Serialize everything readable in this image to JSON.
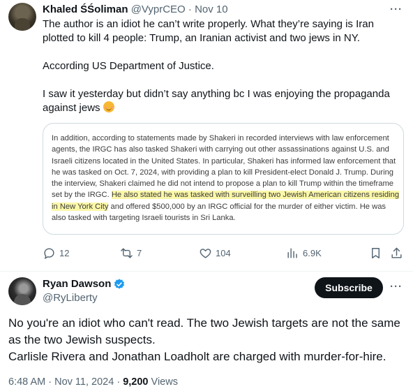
{
  "tweet1": {
    "author_name": "Khaled ŚŚoliman",
    "author_handle": "@VyprCEO",
    "separator": "·",
    "date": "Nov 10",
    "text_line1": "The author is an idiot he can’t write properly. What they’re saying is Iran plotted to kill 4 people: Trump, an Iranian activist and two jews in NY.",
    "text_line2": "According US Department of Justice.",
    "text_line3": "I saw it yesterday but didn’t say anything bc I was enjoying the propaganda against jews",
    "emoji": "smiling-face-with-smiling-eyes",
    "quote_before_highlight": "In addition, according to statements made by Shakeri in recorded interviews with law enforcement agents, the IRGC has also tasked Shakeri with carrying out other assassinations against U.S. and Israeli citizens located in the United States. In particular, Shakeri has informed law enforcement that he was tasked on Oct. 7, 2024, with providing a plan to kill President-elect Donald J. Trump. During the interview, Shakeri claimed he did not intend to propose a plan to kill Trump within the timeframe set by the IRGC. ",
    "quote_highlight": "He also stated he was tasked with surveilling two Jewish American citizens residing in New York City",
    "quote_after_highlight": " and offered $500,000 by an IRGC official for the murder of either victim. He was also tasked with targeting Israeli tourists in Sri Lanka.",
    "highlight_color": "#fbf7a8",
    "actions": {
      "replies": "12",
      "reposts": "7",
      "likes": "104",
      "views": "6.9K"
    }
  },
  "tweet2": {
    "author_name": "Ryan Dawson",
    "author_handle": "@RyLiberty",
    "verified_icon": "verified-badge-icon",
    "subscribe_label": "Subscribe",
    "text_line1": "No you're an idiot who can't read.  The two Jewish targets are not the same as the two Jewish suspects.",
    "text_line2": "Carlisle Rivera and Jonathan Loadholt are charged with murder-for-hire.",
    "time": "6:48 AM",
    "sep1": "·",
    "date": "Nov 11, 2024",
    "sep2": "·",
    "views_count": "9,200",
    "views_label": "Views"
  },
  "colors": {
    "text_primary": "#0f1419",
    "text_secondary": "#536471",
    "verified_blue": "#1d9bf0",
    "border": "#cfd9de",
    "subscribe_bg": "#0f1419"
  }
}
